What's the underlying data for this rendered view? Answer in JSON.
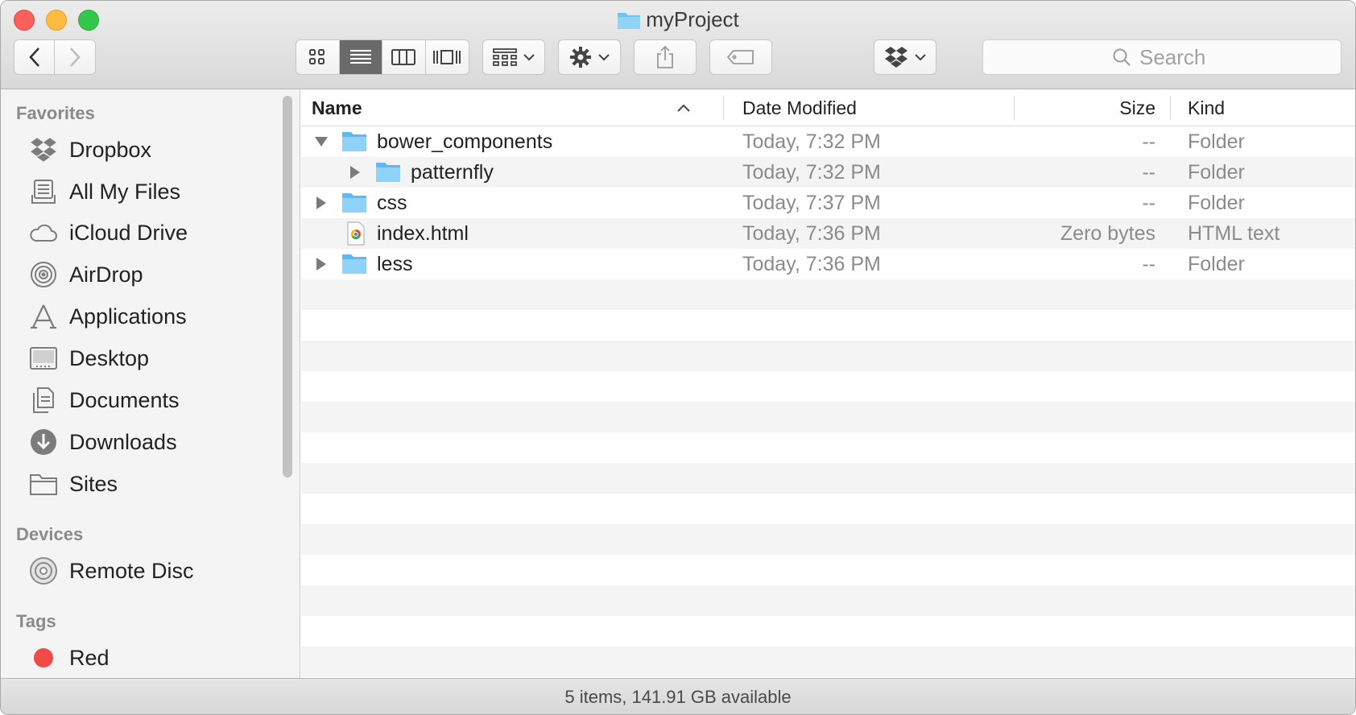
{
  "window": {
    "title": "myProject"
  },
  "toolbar": {
    "back": "back-chevron",
    "forward": "forward-chevron",
    "view_modes": [
      "icon-view",
      "list-view",
      "column-view",
      "cover-flow-view"
    ],
    "active_view": "list-view",
    "arrange": "arrange-grid",
    "action": "gear",
    "share": "share",
    "tags": "tag",
    "dropbox": "dropbox",
    "search_placeholder": "Search"
  },
  "sidebar": {
    "sections": [
      {
        "heading": "Favorites",
        "items": [
          {
            "label": "Dropbox",
            "icon": "dropbox-icon"
          },
          {
            "label": "All My Files",
            "icon": "all-files-icon"
          },
          {
            "label": "iCloud Drive",
            "icon": "cloud-icon"
          },
          {
            "label": "AirDrop",
            "icon": "airdrop-icon"
          },
          {
            "label": "Applications",
            "icon": "applications-icon"
          },
          {
            "label": "Desktop",
            "icon": "desktop-icon"
          },
          {
            "label": "Documents",
            "icon": "documents-icon"
          },
          {
            "label": "Downloads",
            "icon": "downloads-icon"
          },
          {
            "label": "Sites",
            "icon": "folder-icon"
          }
        ]
      },
      {
        "heading": "Devices",
        "items": [
          {
            "label": "Remote Disc",
            "icon": "disc-icon"
          }
        ]
      },
      {
        "heading": "Tags",
        "items": [
          {
            "label": "Red",
            "icon": "tag-dot-icon",
            "color": "#f04b47"
          }
        ]
      }
    ]
  },
  "columns": {
    "name": "Name",
    "date": "Date Modified",
    "size": "Size",
    "kind": "Kind"
  },
  "files": [
    {
      "name": "bower_components",
      "date": "Today, 7:32 PM",
      "size": "--",
      "kind": "Folder",
      "type": "folder",
      "expanded": true
    },
    {
      "name": "patternfly",
      "date": "Today, 7:32 PM",
      "size": "--",
      "kind": "Folder",
      "type": "folder",
      "expanded": false
    },
    {
      "name": "css",
      "date": "Today, 7:37 PM",
      "size": "--",
      "kind": "Folder",
      "type": "folder",
      "expanded": false
    },
    {
      "name": "index.html",
      "date": "Today, 7:36 PM",
      "size": "Zero bytes",
      "kind": "HTML text",
      "type": "html"
    },
    {
      "name": "less",
      "date": "Today, 7:36 PM",
      "size": "--",
      "kind": "Folder",
      "type": "folder",
      "expanded": false
    }
  ],
  "status": "5 items, 141.91 GB available",
  "colors": {
    "folder": "#6cc3f5",
    "selected_view": "#6a6a6a",
    "stripe": "#f4f4f4"
  }
}
